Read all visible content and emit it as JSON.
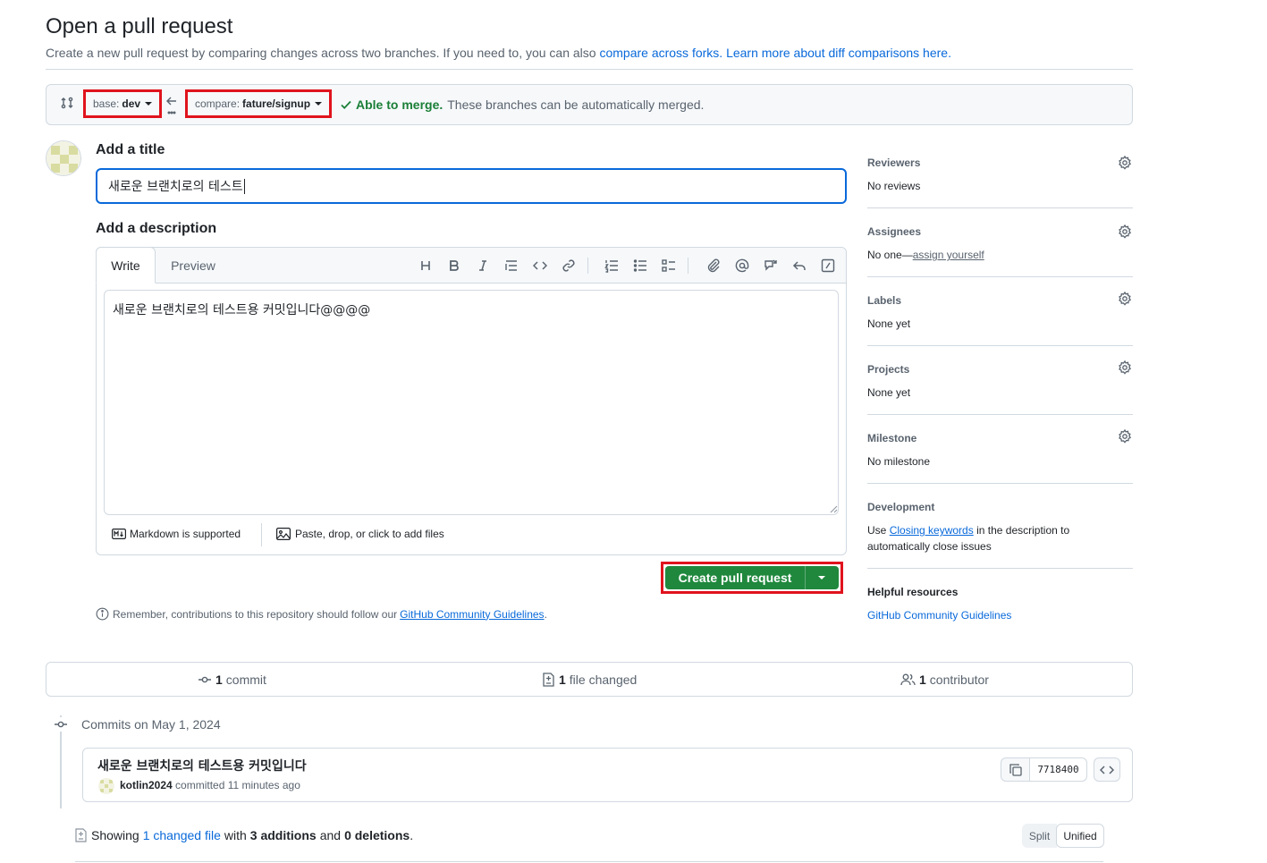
{
  "header": {
    "title": "Open a pull request",
    "subtitle_prefix": "Create a new pull request by comparing changes across two branches. If you need to, you can also",
    "compare_forks_link": "compare across forks.",
    "learn_more_link": "Learn more about diff comparisons here."
  },
  "compare_bar": {
    "base_label": "base:",
    "base_value": "dev",
    "compare_label": "compare:",
    "compare_value": "fature/signup",
    "merge_status": "Able to merge.",
    "merge_message": "These branches can be automatically merged."
  },
  "form": {
    "title_label": "Add a title",
    "title_value": "새로운 브랜치로의 테스트",
    "description_label": "Add a description",
    "tab_write": "Write",
    "tab_preview": "Preview",
    "description_value": "새로운 브랜치로의 테스트용 커밋입니다@@@@",
    "markdown_note": "Markdown is supported",
    "attach_note": "Paste, drop, or click to add files",
    "create_button": "Create pull request",
    "remember_prefix": "Remember, contributions to this repository should follow our",
    "remember_link": "GitHub Community Guidelines",
    "remember_suffix": "."
  },
  "toolbar": {
    "icons": [
      "heading-icon",
      "bold-icon",
      "italic-icon",
      "quote-icon",
      "code-icon",
      "link-icon",
      "ordered-list-icon",
      "unordered-list-icon",
      "task-list-icon",
      "attach-icon",
      "mention-icon",
      "cross-reference-icon",
      "reply-icon",
      "slash-command-icon"
    ]
  },
  "sidebar": {
    "reviewers": {
      "title": "Reviewers",
      "value": "No reviews"
    },
    "assignees": {
      "title": "Assignees",
      "value_prefix": "No one—",
      "value_link": "assign yourself"
    },
    "labels": {
      "title": "Labels",
      "value": "None yet"
    },
    "projects": {
      "title": "Projects",
      "value": "None yet"
    },
    "milestone": {
      "title": "Milestone",
      "value": "No milestone"
    },
    "development": {
      "title": "Development",
      "text_prefix": "Use",
      "link": "Closing keywords",
      "text_suffix_1": "in the description to",
      "text_suffix_2": "automatically close issues"
    },
    "helpful": {
      "title": "Helpful resources",
      "link": "GitHub Community Guidelines"
    }
  },
  "stats": {
    "commits_count": "1",
    "commits_label": "commit",
    "files_count": "1",
    "files_label": "file changed",
    "contributors_count": "1",
    "contributors_label": "contributor"
  },
  "commits": {
    "group_label": "Commits on May 1, 2024",
    "items": [
      {
        "message": "새로운 브랜치로의 테스트용 커밋입니다",
        "author": "kotlin2024",
        "meta": "committed 11 minutes ago",
        "sha": "7718400"
      }
    ]
  },
  "diff_summary": {
    "showing": "Showing",
    "changed_link": "1 changed file",
    "with": "with",
    "additions": "3 additions",
    "and": "and",
    "deletions": "0 deletions",
    "end": ".",
    "split": "Split",
    "unified": "Unified"
  },
  "colors": {
    "accent": "#0969da",
    "success": "#1a7f37",
    "button_green": "#1f883d",
    "highlight_red": "#e0131d"
  }
}
